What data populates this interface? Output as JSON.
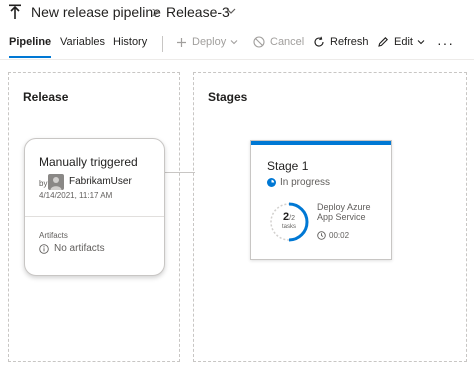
{
  "header": {
    "title": "New release pipeline",
    "separator": ">",
    "release_name": "Release-3"
  },
  "tabs": [
    {
      "label": "Pipeline",
      "active": true
    },
    {
      "label": "Variables",
      "active": false
    },
    {
      "label": "History",
      "active": false
    }
  ],
  "toolbar": {
    "deploy_label": "Deploy",
    "cancel_label": "Cancel",
    "refresh_label": "Refresh",
    "edit_label": "Edit",
    "more_label": "···"
  },
  "release_panel": {
    "title": "Release",
    "artifact_card": {
      "trigger": "Manually triggered",
      "by_label": "by",
      "user": "FabrikamUser",
      "date": "4/14/2021, 11:17 AM",
      "artifacts_label": "Artifacts",
      "artifacts_value": "No artifacts"
    }
  },
  "stages_panel": {
    "title": "Stages",
    "stage": {
      "name": "Stage 1",
      "status": "In progress",
      "tasks_done": "2",
      "tasks_total": "/2",
      "tasks_label": "tasks",
      "task_name": "Deploy Azure App Service",
      "duration": "00:02"
    }
  },
  "colors": {
    "accent": "#0078d4",
    "border": "#c8c6c4",
    "text": "#201f1e",
    "muted": "#605e5c"
  }
}
